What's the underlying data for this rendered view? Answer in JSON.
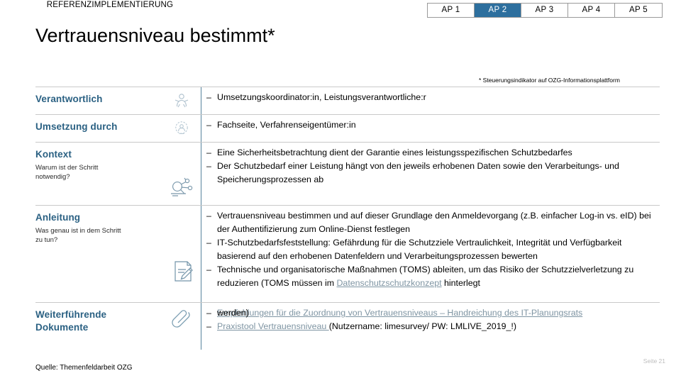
{
  "header": {
    "kicker": "REFERENZIMPLEMENTIERUNG",
    "title": "Vertrauensniveau bestimmt*"
  },
  "tabs": [
    {
      "label": "AP 1",
      "active": false
    },
    {
      "label": "AP 2",
      "active": true
    },
    {
      "label": "AP 3",
      "active": false
    },
    {
      "label": "AP 4",
      "active": false
    },
    {
      "label": "AP 5",
      "active": false
    }
  ],
  "footnote": "* Steuerungsindikator auf OZG-Informationsplattform",
  "rows": {
    "verantwortlich": {
      "label": "Verantwortlich",
      "sublabel": "",
      "icon": "person-icon",
      "bullets": [
        "Umsetzungskoordinator:in, Leistungsverantwortliche:r"
      ]
    },
    "umsetzung": {
      "label": "Umsetzung durch",
      "sublabel": "",
      "icon": "group-gear-icon",
      "bullets": [
        "Fachseite, Verfahrenseigentümer:in"
      ]
    },
    "kontext": {
      "label": "Kontext",
      "sublabel": "Warum ist der Schritt notwendig?",
      "icon": "magnifier-analysis-icon",
      "bullets": [
        "Eine Sicherheitsbetrachtung dient der Garantie eines leistungsspezifischen Schutzbedarfes",
        "Der Schutzbedarf einer Leistung hängt von den jeweils erhobenen Daten sowie den Verarbeitungs- und Speicherungsprozessen ab"
      ]
    },
    "anleitung": {
      "label": "Anleitung",
      "sublabel": "Was genau ist in dem Schritt zu tun?",
      "icon": "document-pencil-icon",
      "bullets": [
        "Vertrauensniveau bestimmen und auf dieser Grundlage den Anmeldevorgang (z.B. einfacher Log-in vs. eID) bei der Authentifizierung zum Online-Dienst festlegen",
        "IT-Schutzbedarfsfeststellung: Gefährdung für die Schutzziele Vertraulichkeit, Integrität und Verfügbarkeit basierend auf den erhobenen Datenfeldern und Verarbeitungsprozessen bewerten"
      ],
      "bullet3": {
        "pre": "Technische und organisatorische Maßnahmen (TOMS) ableiten, um das Risiko der Schutzzielverletzung zu reduzieren (TOMS müssen im ",
        "link": "Datenschutzschutzkonzept",
        "post": " hinterlegt ",
        "overlap": "werden)"
      }
    },
    "dokumente": {
      "label": "Weiterführende Dokumente",
      "sublabel": "",
      "icon": "paperclip-icon",
      "bullet1_link": "Empfehlungen für die Zuordnung von Vertrauensniveaus – Handreichung des IT-Planungsrats",
      "bullet2_link": "Praxistool Vertrauensniveau ",
      "bullet2_rest": "(Nutzername: limesurvey/ PW: LMLIVE_2019_!)"
    }
  },
  "footer": {
    "source": "Quelle: Themenfeldarbeit OZG",
    "page": "Seite 21"
  },
  "colors": {
    "label_blue": "#2b6183",
    "tab_active": "#2d6f9e",
    "link": "#7f95a3",
    "rule": "#c9c9c9"
  }
}
